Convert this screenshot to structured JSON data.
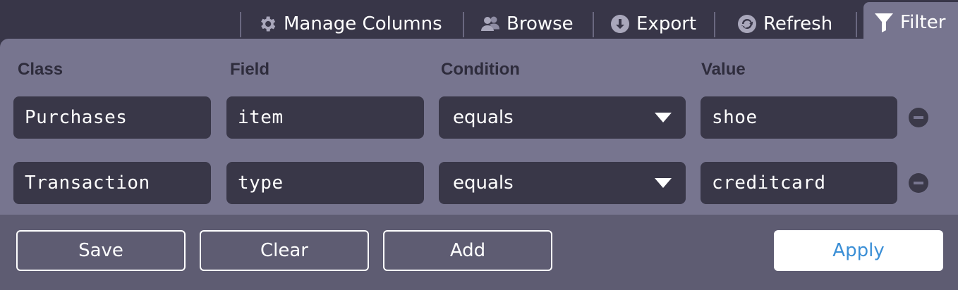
{
  "toolbar": {
    "manage_columns": "Manage Columns",
    "browse": "Browse",
    "export": "Export",
    "refresh": "Refresh",
    "filter": "Filter"
  },
  "columns": {
    "class": "Class",
    "field": "Field",
    "condition": "Condition",
    "value": "Value"
  },
  "rows": [
    {
      "class": "Purchases",
      "field": "item",
      "condition": "equals",
      "value": "shoe"
    },
    {
      "class": "Transaction",
      "field": "type",
      "condition": "equals",
      "value": "creditcard"
    }
  ],
  "footer": {
    "save": "Save",
    "clear": "Clear",
    "add": "Add",
    "apply": "Apply"
  },
  "colors": {
    "background": "#383648",
    "panel": "#77758f",
    "footer": "#5e5c72",
    "apply_text": "#3b8fd6"
  }
}
